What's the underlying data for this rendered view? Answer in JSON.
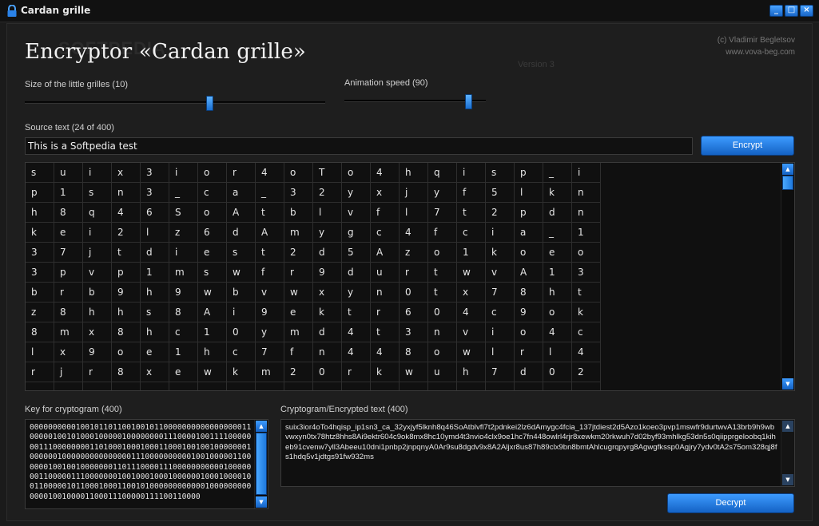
{
  "window": {
    "title": "Cardan grille",
    "minimize": "_",
    "maximize": "□",
    "close": "×"
  },
  "header": {
    "app_title": "Encryptor «Cardan grille»",
    "watermark": "SOFTPEDIA",
    "author": "(c) Vladimir Begletsov",
    "website": "www.vova-beg.com",
    "version": "Version 3"
  },
  "controls": {
    "grille_size_label": "Size of the little grilles (10)",
    "grille_size_value": 10,
    "animation_speed_label": "Animation speed (90)",
    "animation_speed_value": 90,
    "source_label": "Source text (24 of 400)",
    "source_value": "This is a Softpedia test",
    "encrypt_label": "Encrypt",
    "decrypt_label": "Decrypt"
  },
  "grid": {
    "rows": [
      [
        "s",
        "u",
        "i",
        "x",
        "3",
        "i",
        "o",
        "r",
        "4",
        "o",
        "T",
        "o",
        "4",
        "h",
        "q",
        "i",
        "s",
        "p",
        "_",
        "i"
      ],
      [
        "p",
        "1",
        "s",
        "n",
        "3",
        "_",
        "c",
        "a",
        "_",
        "3",
        "2",
        "y",
        "x",
        "j",
        "y",
        "f",
        "5",
        "l",
        "k",
        "n"
      ],
      [
        "h",
        "8",
        "q",
        "4",
        "6",
        "S",
        "o",
        "A",
        "t",
        "b",
        "l",
        "v",
        "f",
        "l",
        "7",
        "t",
        "2",
        "p",
        "d",
        "n"
      ],
      [
        "k",
        "e",
        "i",
        "2",
        "l",
        "z",
        "6",
        "d",
        "A",
        "m",
        "y",
        "g",
        "c",
        "4",
        "f",
        "c",
        "i",
        "a",
        "_",
        "1"
      ],
      [
        "3",
        "7",
        "j",
        "t",
        "d",
        "i",
        "e",
        "s",
        "t",
        "2",
        "d",
        "5",
        "A",
        "z",
        "o",
        "1",
        "k",
        "o",
        "e",
        "o"
      ],
      [
        "3",
        "p",
        "v",
        "p",
        "1",
        "m",
        "s",
        "w",
        "f",
        "r",
        "9",
        "d",
        "u",
        "r",
        "t",
        "w",
        "v",
        "A",
        "1",
        "3"
      ],
      [
        "b",
        "r",
        "b",
        "9",
        "h",
        "9",
        "w",
        "b",
        "v",
        "w",
        "x",
        "y",
        "n",
        "0",
        "t",
        "x",
        "7",
        "8",
        "h",
        "t"
      ],
      [
        "z",
        "8",
        "h",
        "h",
        "s",
        "8",
        "A",
        "i",
        "9",
        "e",
        "k",
        "t",
        "r",
        "6",
        "0",
        "4",
        "c",
        "9",
        "o",
        "k"
      ],
      [
        "8",
        "m",
        "x",
        "8",
        "h",
        "c",
        "1",
        "0",
        "y",
        "m",
        "d",
        "4",
        "t",
        "3",
        "n",
        "v",
        "i",
        "o",
        "4",
        "c"
      ],
      [
        "l",
        "x",
        "9",
        "o",
        "e",
        "1",
        "h",
        "c",
        "7",
        "f",
        "n",
        "4",
        "4",
        "8",
        "o",
        "w",
        "l",
        "r",
        "l",
        "4"
      ],
      [
        "r",
        "j",
        "r",
        "8",
        "x",
        "e",
        "w",
        "k",
        "m",
        "2",
        "0",
        "r",
        "k",
        "w",
        "u",
        "h",
        "7",
        "d",
        "0",
        "2"
      ],
      [
        "",
        "",
        "",
        "",
        "",
        "",
        "",
        "",
        "",
        "",
        "",
        "",
        "",
        "",
        "",
        "",
        "",
        "",
        "",
        ""
      ]
    ]
  },
  "key": {
    "label": "Key for cryptogram (400)",
    "text": "0000000000100101101100100101100000000000000000110000010010100010000010000000011100001001111000000011100000000110100010001000110001001001000000010000001000000000000000111000000000010010000011000000100100100000001101110000111000000000001000000011000001110000000100100010001000000100010000100110000010110001000110010100000000000010000000000000100100001100011100000111100110000"
  },
  "cryptogram": {
    "label": "Cryptogram/Encrypted text (400)",
    "text": "suix3ior4oTo4hqisp_ip1sn3_ca_32yxjyf5lknh8q46SoAtblvfl7t2pdnkei2lz6dAmygc4fcia_137jtdiest2d5Azo1koeo3pvp1mswfr9durtwvA13brb9h9wbvwxyn0tx78htz8hhs8Ai9ektr604c9ok8mx8hc10ymd4t3nvio4clx9oe1hc7fn448owlrl4rjr8xewkm20rkwuh7d02byf93mhlkg53dn5s0qiipprgeloobq1kiheb91cvenw7yll3Abeeu10dni1pnbp2jnpqnyA0Ar9su8dgdv9x8A2Aljxr8us87h89clx9bn8bmtAhlcugrqpyrg8Agwgfkssp0Agjry7ydv0tA2s75om328qj8fs1hdq5v1jdtgs91fw932ms"
  }
}
